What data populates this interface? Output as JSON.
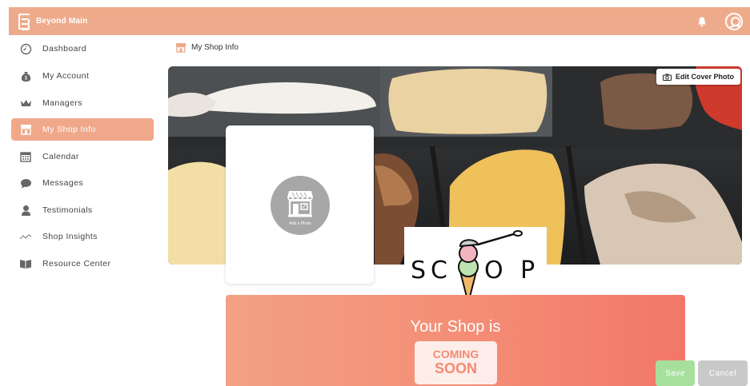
{
  "app": {
    "brand": "Beyond Main"
  },
  "topbar": {
    "bell_icon": "bell-icon",
    "avatar_icon": "user-avatar-icon"
  },
  "sidebar": {
    "items": [
      {
        "label": "Dashboard",
        "icon": "dashboard-icon",
        "active": false
      },
      {
        "label": "My Account",
        "icon": "money-bag-icon",
        "active": false
      },
      {
        "label": "Managers",
        "icon": "crown-icon",
        "active": false
      },
      {
        "label": "My Shop Info",
        "icon": "storefront-icon",
        "active": true
      },
      {
        "label": "Calendar",
        "icon": "calendar-icon",
        "active": false
      },
      {
        "label": "Messages",
        "icon": "chat-bubble-icon",
        "active": false
      },
      {
        "label": "Testimonials",
        "icon": "person-icon",
        "active": false
      },
      {
        "label": "Shop Insights",
        "icon": "trend-line-icon",
        "active": false
      },
      {
        "label": "Resource Center",
        "icon": "book-icon",
        "active": false
      }
    ]
  },
  "main": {
    "breadcrumb": "My Shop Info",
    "edit_cover_label": "Edit Cover Photo",
    "add_photo_label": "Add a Photo",
    "logo_text": "SCOOP",
    "banner_title": "Your Shop is",
    "coming_line1": "COMING",
    "coming_line2": "SOON"
  },
  "buttons": {
    "save": "Save",
    "cancel": "Cancel"
  },
  "colors": {
    "accent": "#eeab8c",
    "active_nav": "#f0a88a",
    "save": "#a6e09c",
    "cancel": "#c9c9c9"
  }
}
